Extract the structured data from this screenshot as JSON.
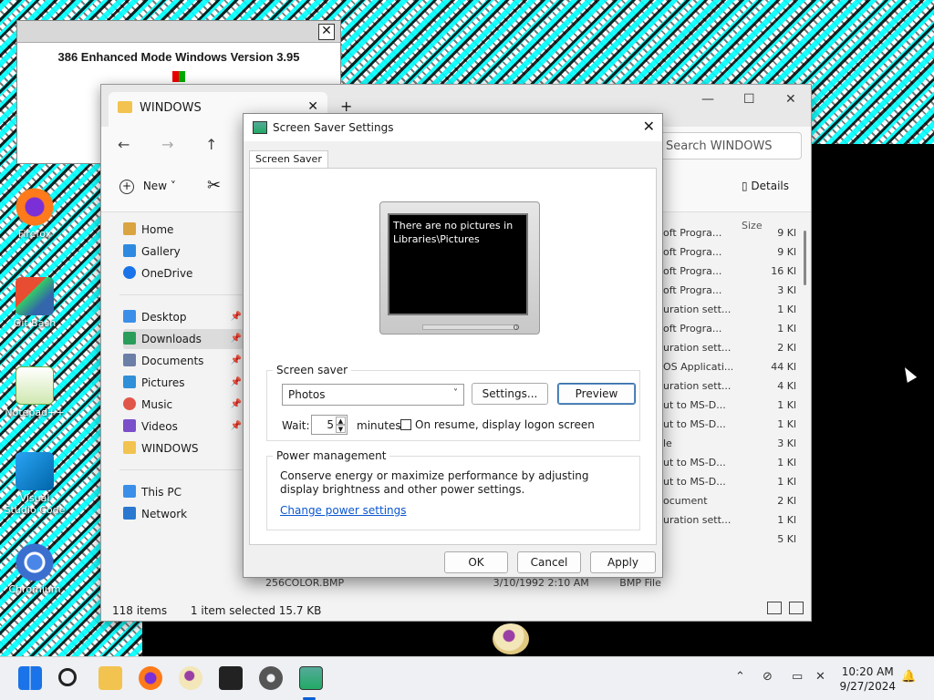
{
  "desktop": {
    "icons": [
      {
        "label": "Firefox",
        "icon": "firefox-icon"
      },
      {
        "label": "Git Bash",
        "icon": "git-bash-icon"
      },
      {
        "label": "Notepad++",
        "icon": "notepad-plus-plus-icon"
      },
      {
        "label": "Visual Studio Code",
        "icon": "vscode-icon"
      },
      {
        "label": "Chromium",
        "icon": "chromium-icon"
      }
    ]
  },
  "old_dialog": {
    "version_text": "386 Enhanced Mode Windows Version 3.95",
    "close_label": "✕"
  },
  "explorer": {
    "tab_title": "WINDOWS",
    "new_tab": "+",
    "search_placeholder": "Search WINDOWS",
    "new_label": "New",
    "details_label": "Details",
    "nav": {
      "home": "Home",
      "gallery": "Gallery",
      "onedrive": "OneDrive",
      "desktop": "Desktop",
      "downloads": "Downloads",
      "documents": "Documents",
      "pictures": "Pictures",
      "music": "Music",
      "videos": "Videos",
      "windows": "WINDOWS",
      "thispc": "This PC",
      "network": "Network"
    },
    "size_header": "Size",
    "rows": [
      {
        "type": "oft Progra...",
        "size": "9 Kl"
      },
      {
        "type": "oft Progra...",
        "size": "9 Kl"
      },
      {
        "type": "oft Progra...",
        "size": "16 Kl"
      },
      {
        "type": "oft Progra...",
        "size": "3 Kl"
      },
      {
        "type": "uration sett...",
        "size": "1 Kl"
      },
      {
        "type": "oft Progra...",
        "size": "1 Kl"
      },
      {
        "type": "uration sett...",
        "size": "2 Kl"
      },
      {
        "type": "OS Applicati...",
        "size": "44 Kl"
      },
      {
        "type": "uration sett...",
        "size": "4 Kl"
      },
      {
        "type": "ut to MS-D...",
        "size": "1 Kl"
      },
      {
        "type": "ut to MS-D...",
        "size": "1 Kl"
      },
      {
        "type": "le",
        "size": "3 Kl"
      },
      {
        "type": "ut to MS-D...",
        "size": "1 Kl"
      },
      {
        "type": "ut to MS-D...",
        "size": "1 Kl"
      },
      {
        "type": "ocument",
        "size": "2 Kl"
      },
      {
        "type": "uration sett...",
        "size": "1 Kl"
      },
      {
        "type": "",
        "size": "5 Kl"
      }
    ],
    "partial_row": {
      "name": "256COLOR.BMP",
      "date": "3/10/1992 2:10 AM",
      "type": "BMP File"
    },
    "status_items": "118 items",
    "status_selected": "1 item selected  15.7 KB"
  },
  "screensaver": {
    "title": "Screen Saver Settings",
    "tab": "Screen Saver",
    "preview_text": "There are no pictures in Libraries\\Pictures",
    "group_saver": "Screen saver",
    "selected": "Photos",
    "settings_btn": "Settings...",
    "preview_btn": "Preview",
    "wait_label": "Wait:",
    "wait_value": "5",
    "minutes_label": "minutes",
    "resume_label": "On resume, display logon screen",
    "group_power": "Power management",
    "power_desc": "Conserve energy or maximize performance by adjusting display brightness and other power settings.",
    "power_link": "Change power settings",
    "ok": "OK",
    "cancel": "Cancel",
    "apply": "Apply"
  },
  "taskbar": {
    "time": "10:20 AM",
    "date": "9/27/2024"
  },
  "colors": {
    "accent": "#0a5fd4",
    "desktop_teal": "#2c9c9c"
  }
}
